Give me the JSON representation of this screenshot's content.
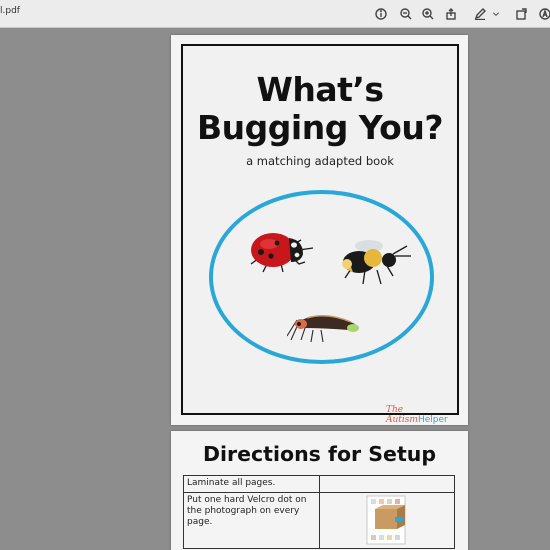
{
  "toolbar": {
    "filename": "l.pdf",
    "icons": [
      "info-icon",
      "zoom-out-icon",
      "zoom-in-icon",
      "share-icon",
      "markup-icon",
      "chevron-down-icon",
      "rotate-icon",
      "accessibility-icon"
    ]
  },
  "page1": {
    "title_line1": "What’s",
    "title_line2": "Bugging You?",
    "subtitle": "a matching adapted book",
    "brand_part1": "The Autism",
    "brand_part2": "Helper",
    "images": [
      "ladybug",
      "bumblebee",
      "firefly"
    ],
    "colors": {
      "oval": "#2aa7d9",
      "brand_red": "#e35b3c",
      "brand_blue": "#2aa7d9"
    }
  },
  "page2": {
    "title": "Directions for Setup",
    "rows": [
      {
        "text": "Laminate all pages.",
        "image": ""
      },
      {
        "text": "Put one hard Velcro dot on the photograph on every page.",
        "image": "velcro-page-photo"
      }
    ]
  }
}
